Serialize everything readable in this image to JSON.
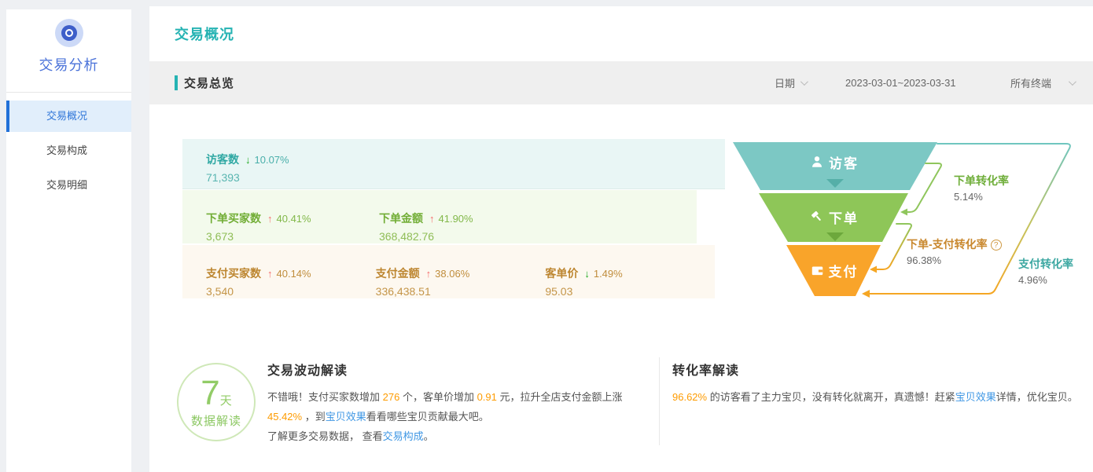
{
  "sidebar": {
    "title": "交易分析",
    "items": [
      {
        "label": "交易概况",
        "active": true
      },
      {
        "label": "交易构成",
        "active": false
      },
      {
        "label": "交易明细",
        "active": false
      }
    ]
  },
  "header": {
    "title": "交易概况"
  },
  "overview": {
    "title": "交易总览",
    "date_label": "日期",
    "date_range": "2023-03-01~2023-03-31",
    "terminal": "所有终端"
  },
  "metrics": {
    "rows": [
      {
        "theme": "teal",
        "cells": [
          {
            "label": "访客数",
            "dir": "down",
            "pct": "10.07%",
            "value": "71,393"
          }
        ]
      },
      {
        "theme": "green",
        "cells": [
          {
            "label": "下单买家数",
            "dir": "up",
            "pct": "40.41%",
            "value": "3,673"
          },
          {
            "label": "下单金额",
            "dir": "up",
            "pct": "41.90%",
            "value": "368,482.76"
          }
        ]
      },
      {
        "theme": "orange",
        "cells": [
          {
            "label": "支付买家数",
            "dir": "up",
            "pct": "40.14%",
            "value": "3,540"
          },
          {
            "label": "支付金额",
            "dir": "up",
            "pct": "38.06%",
            "value": "336,438.51"
          },
          {
            "label": "客单价",
            "dir": "down",
            "pct": "1.49%",
            "value": "95.03"
          }
        ]
      }
    ]
  },
  "funnel": {
    "stages": [
      {
        "label": "访客",
        "color": "#7cc8c4"
      },
      {
        "label": "下单",
        "color": "#8ec658"
      },
      {
        "label": "支付",
        "color": "#f9a42a"
      }
    ],
    "conversions": [
      {
        "label": "下单转化率",
        "value": "5.14%"
      },
      {
        "label": "下单-支付转化率",
        "value": "96.38%",
        "help": "?"
      },
      {
        "label": "支付转化率",
        "value": "4.96%"
      }
    ]
  },
  "chart_data": {
    "type": "funnel",
    "stages": [
      "访客",
      "下单",
      "支付"
    ],
    "stage_values": [
      71393,
      3673,
      3540
    ],
    "conversion_rates": {
      "下单转化率": 5.14,
      "下单-支付转化率": 96.38,
      "支付转化率": 4.96
    },
    "colors": [
      "#7cc8c4",
      "#8ec658",
      "#f9a42a"
    ]
  },
  "insight": {
    "badge": {
      "days": "7",
      "unit": "天",
      "caption": "数据解读"
    },
    "fluctuation": {
      "title": "交易波动解读",
      "p1": {
        "s1": "不错哦！支付买家数增加 ",
        "v1": "276",
        "s2": " 个，客单价增加 ",
        "v2": "0.91",
        "s3": " 元，拉升全店支付金额上涨 ",
        "v3": "45.42%",
        "s4": " ，到",
        "link1": "宝贝效果",
        "s5": "看看哪些宝贝贡献最大吧。"
      },
      "p2": {
        "s1": "了解更多交易数据， 查看",
        "link1": "交易构成",
        "s2": "。"
      }
    },
    "conversion": {
      "title": "转化率解读",
      "p1": {
        "v1": " 96.62% ",
        "s1": "的访客看了主力宝贝，没有转化就离开，真遗憾！赶紧",
        "link1": "宝贝效果",
        "s2": "详情，优化宝贝。"
      }
    }
  }
}
